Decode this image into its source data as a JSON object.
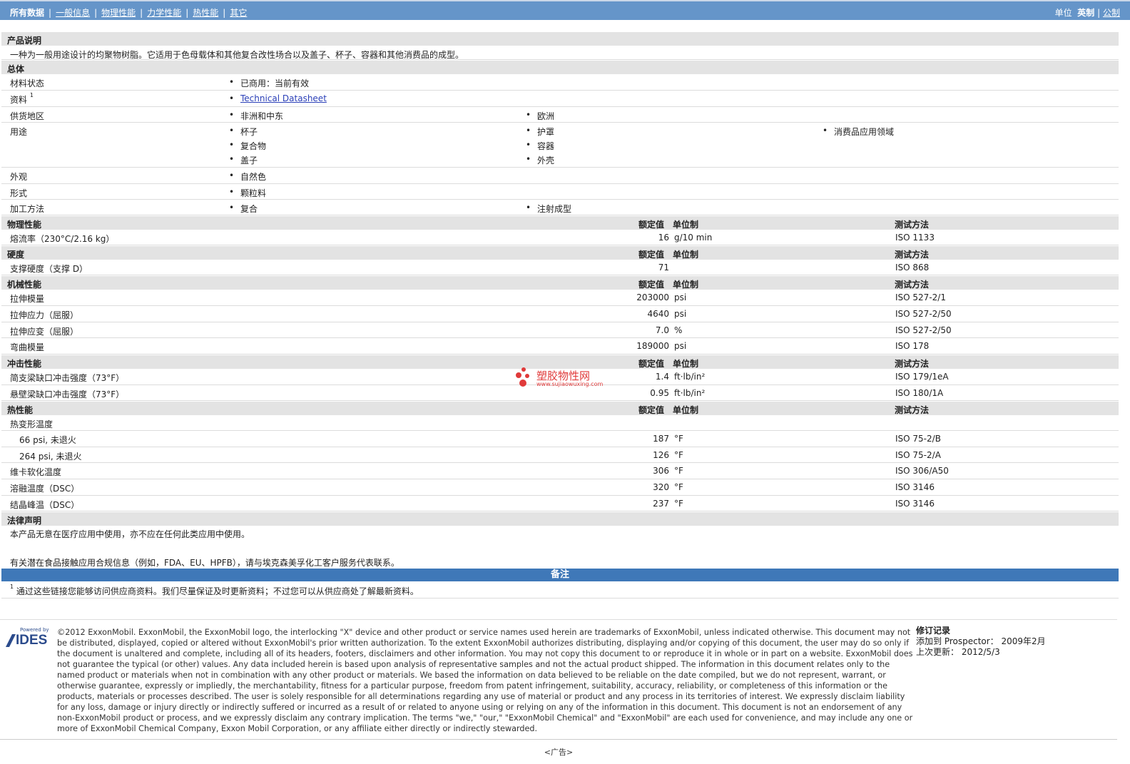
{
  "nav": {
    "items": [
      "所有数据",
      "一般信息",
      "物理性能",
      "力学性能",
      "热性能",
      "其它"
    ],
    "units_label": "单位",
    "unit_current": "英制",
    "unit_other": "公制"
  },
  "product": {
    "title": "产品说明",
    "desc": "一种为一般用途设计的均聚物树脂。它适用于色母载体和其他复合改性场合以及盖子、杯子、容器和其他消费品的成型。"
  },
  "general": {
    "title": "总体",
    "status_label": "材料状态",
    "status": "已商用：当前有效",
    "docs_label": "资料",
    "docs_sup": "1",
    "docs_link": "Technical Datasheet",
    "supply_label": "供货地区",
    "supply": [
      "非洲和中东",
      "欧洲"
    ],
    "uses_label": "用途",
    "uses": [
      "杯子",
      "复合物",
      "盖子",
      "护罩",
      "容器",
      "外壳",
      "消费品应用领域"
    ],
    "appearance_label": "外观",
    "appearance": "自然色",
    "form_label": "形式",
    "form": "颗粒料",
    "process_label": "加工方法",
    "process": [
      "复合",
      "注射成型"
    ]
  },
  "headers": {
    "nominal": "额定值",
    "unit": "单位制",
    "method": "测试方法"
  },
  "physical": {
    "title": "物理性能",
    "rows": [
      {
        "label": "熔流率（230°C/2.16 kg）",
        "value": "16",
        "unit": "g/10 min",
        "method": "ISO 1133"
      }
    ]
  },
  "hardness": {
    "title": "硬度",
    "rows": [
      {
        "label": "支撑硬度（支撑 D）",
        "value": "71",
        "unit": "",
        "method": "ISO 868"
      }
    ]
  },
  "mechanical": {
    "title": "机械性能",
    "rows": [
      {
        "label": "拉伸模量",
        "value": "203000",
        "unit": "psi",
        "method": "ISO 527-2/1"
      },
      {
        "label": "拉伸应力（屈服）",
        "value": "4640",
        "unit": "psi",
        "method": "ISO 527-2/50"
      },
      {
        "label": "拉伸应变（屈服）",
        "value": "7.0",
        "unit": "%",
        "method": "ISO 527-2/50"
      },
      {
        "label": "弯曲模量",
        "value": "189000",
        "unit": "psi",
        "method": "ISO 178"
      }
    ]
  },
  "impact": {
    "title": "冲击性能",
    "rows": [
      {
        "label": "简支梁缺口冲击强度（73°F）",
        "value": "1.4",
        "unit": "ft·lb/in²",
        "method": "ISO 179/1eA"
      },
      {
        "label": "悬壁梁缺口冲击强度（73°F）",
        "value": "0.95",
        "unit": "ft·lb/in²",
        "method": "ISO 180/1A"
      }
    ]
  },
  "thermal": {
    "title": "热性能",
    "hdt_label": "热变形温度",
    "rows": [
      {
        "label": "66 psi, 未退火",
        "value": "187",
        "unit": "°F",
        "method": "ISO 75-2/B"
      },
      {
        "label": "264 psi, 未退火",
        "value": "126",
        "unit": "°F",
        "method": "ISO 75-2/A"
      },
      {
        "label": "维卡软化温度",
        "value": "306",
        "unit": "°F",
        "method": "ISO 306/A50"
      },
      {
        "label": "溶融温度（DSC）",
        "value": "320",
        "unit": "°F",
        "method": "ISO 3146"
      },
      {
        "label": "结晶峰温（DSC）",
        "value": "237",
        "unit": "°F",
        "method": "ISO 3146"
      }
    ]
  },
  "legal": {
    "title": "法律声明",
    "line1": "本产品无意在医疗应用中使用，亦不应在任何此类应用中使用。",
    "line2": "有关潜在食品接触应用合规信息（例如，FDA、EU、HPFB），请与埃克森美孚化工客户服务代表联系。"
  },
  "notes": {
    "title": "备注",
    "sup": "1",
    "text": "通过这些链接您能够访问供应商资料。我们尽量保证及时更新资料；不过您可以从供应商处了解最新资料。"
  },
  "footer": {
    "logo_powered": "Powered by",
    "logo_text": "IDES",
    "legal": "©2012 ExxonMobil. ExxonMobil, the ExxonMobil logo, the interlocking \"X\" device and other product or service names used herein are trademarks of ExxonMobil, unless indicated otherwise. This document may not be distributed, displayed, copied or altered without ExxonMobil's prior written authorization. To the extent ExxonMobil authorizes distributing, displaying and/or copying of this document, the user may do so only if the document is unaltered and complete, including all of its headers, footers, disclaimers and other information. You may not copy this document to or reproduce it in whole or in part on a website. ExxonMobil does not guarantee the typical (or other) values. Any data included herein is based upon analysis of representative samples and not the actual product shipped. The information in this document relates only to the named product or materials when not in combination with any other product or materials. We based the information on data believed to be reliable on the date compiled, but we do not represent, warrant, or otherwise guarantee, expressly or impliedly, the merchantability, fitness for a particular purpose, freedom from patent infringement, suitability, accuracy, reliability, or completeness of this information or the products, materials or processes described. The user is solely responsible for all determinations regarding any use of material or product and any process in its territories of interest. We expressly disclaim liability for any loss, damage or injury directly or indirectly suffered or incurred as a result of or related to anyone using or relying on any of the information in this document. This document is not an endorsement of any non-ExxonMobil product or process, and we expressly disclaim any contrary implication. The terms \"we,\" \"our,\" \"ExxonMobil Chemical\" and \"ExxonMobil\" are each used for convenience, and may include any one or more of ExxonMobil Chemical Company, Exxon Mobil Corporation, or any affiliate either directly or indirectly stewarded.",
    "rev_title": "修订记录",
    "rev_added": "添加到 Prospector： 2009年2月",
    "rev_updated": "上次更新： 2012/5/3",
    "ad": "<广告>"
  },
  "watermark": {
    "cn": "塑胶物性网",
    "url": "www.sujiaowuxing.com"
  }
}
